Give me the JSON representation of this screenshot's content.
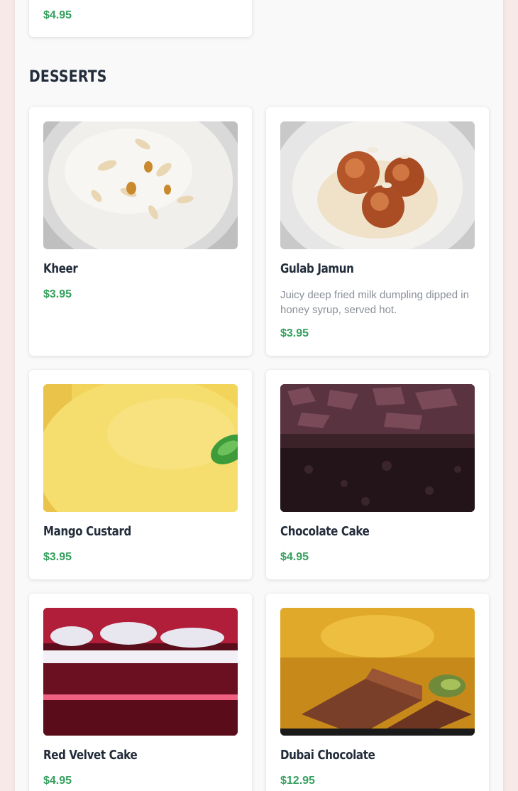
{
  "previous_item": {
    "price": "$4.95"
  },
  "section": {
    "title": "DESSERTS"
  },
  "items": [
    {
      "name": "Kheer",
      "price": "$3.95",
      "image_icon": "kheer-image"
    },
    {
      "name": "Gulab Jamun",
      "description": "Juicy deep fried milk dumpling dipped in honey syrup, served hot.",
      "price": "$3.95",
      "image_icon": "gulab-jamun-image"
    },
    {
      "name": "Mango Custard",
      "price": "$3.95",
      "image_icon": "mango-custard-image"
    },
    {
      "name": "Chocolate Cake",
      "price": "$4.95",
      "image_icon": "chocolate-cake-image"
    },
    {
      "name": "Red Velvet Cake",
      "price": "$4.95",
      "image_icon": "red-velvet-cake-image"
    },
    {
      "name": "Dubai Chocolate",
      "price": "$12.95",
      "image_icon": "dubai-chocolate-image"
    }
  ],
  "colors": {
    "price": "#35a05e",
    "title": "#222c3a",
    "background": "#f8e9e9"
  }
}
